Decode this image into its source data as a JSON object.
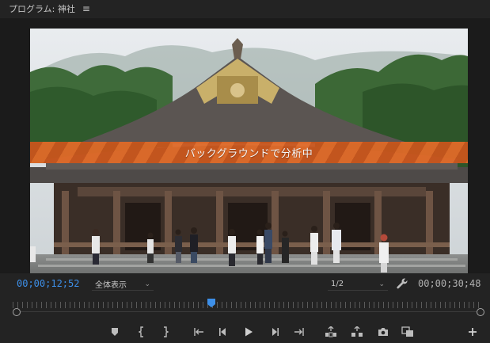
{
  "panel": {
    "title": "プログラム: 神社",
    "menu_icon": "hamburger-menu-icon"
  },
  "viewer": {
    "overlay_text": "バックグラウンドで分析中"
  },
  "controls": {
    "current_timecode": "00;00;12;52",
    "zoom_label": "全体表示",
    "resolution_label": "1/2",
    "duration_timecode": "00;00;30;48"
  },
  "colors": {
    "accent": "#3d8fe8",
    "banner": "#d8601f",
    "background": "#232323"
  },
  "playback": {
    "playhead_fraction": 0.42
  },
  "transport_icons": [
    "add-marker-icon",
    "mark-in-icon",
    "mark-out-icon",
    "go-to-in-icon",
    "step-back-icon",
    "play-icon",
    "step-forward-icon",
    "go-to-out-icon",
    "lift-icon",
    "extract-icon",
    "export-frame-icon",
    "comparison-view-icon",
    "button-editor-icon"
  ]
}
